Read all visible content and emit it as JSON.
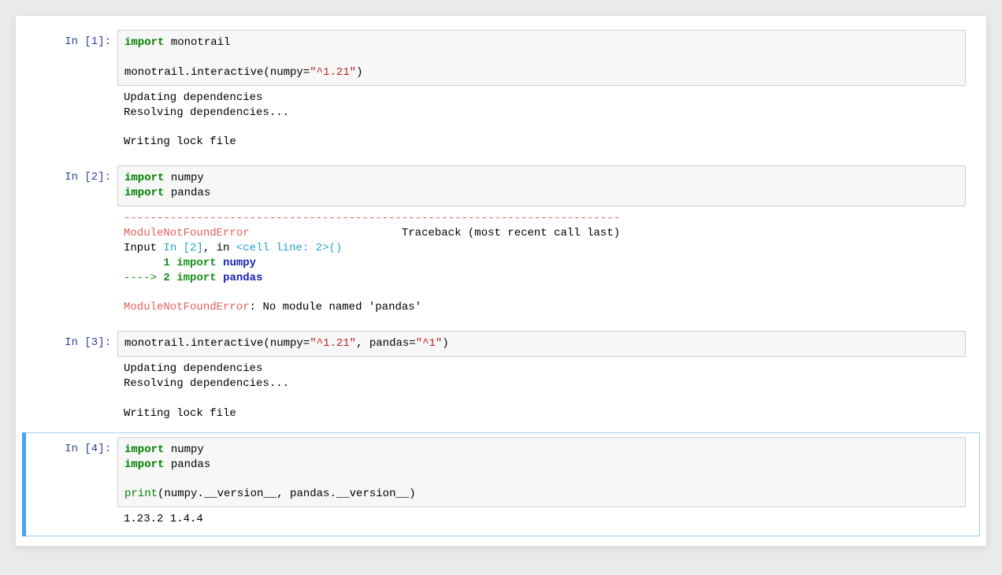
{
  "cells": [
    {
      "selected": false,
      "prompt": "In [1]:",
      "code_tokens": [
        [
          "kw",
          "import"
        ],
        [
          "sp",
          " "
        ],
        [
          "txt",
          "monotrail"
        ],
        [
          "nl"
        ],
        [
          "nl"
        ],
        [
          "txt",
          "monotrail.interactive(numpy"
        ],
        [
          "punct",
          "="
        ],
        [
          "str",
          "\"^1.21\""
        ],
        [
          "txt",
          ")"
        ]
      ],
      "output_segments": [
        {
          "type": "plain",
          "text": "Updating dependencies\nResolving dependencies...\n\nWriting lock file"
        }
      ]
    },
    {
      "selected": false,
      "prompt": "In [2]:",
      "code_tokens": [
        [
          "kw",
          "import"
        ],
        [
          "sp",
          " "
        ],
        [
          "txt",
          "numpy"
        ],
        [
          "nl"
        ],
        [
          "kw",
          "import"
        ],
        [
          "sp",
          " "
        ],
        [
          "txt",
          "pandas"
        ]
      ],
      "output_segments": [
        {
          "type": "err-dash",
          "text": "---------------------------------------------------------------------------"
        },
        {
          "type": "nl"
        },
        {
          "type": "err-name",
          "text": "ModuleNotFoundError"
        },
        {
          "type": "plain",
          "text": "                       Traceback (most recent call last)"
        },
        {
          "type": "nl"
        },
        {
          "type": "plain",
          "text": "Input "
        },
        {
          "type": "cell-loc",
          "text": "In [2]"
        },
        {
          "type": "plain",
          "text": ", in "
        },
        {
          "type": "cell-loc",
          "text": "<cell line: 2>"
        },
        {
          "type": "cell-loc",
          "text": "()"
        },
        {
          "type": "nl"
        },
        {
          "type": "num",
          "text": "      1"
        },
        {
          "type": "plain",
          "text": " "
        },
        {
          "type": "kw",
          "text": "import"
        },
        {
          "type": "plain",
          "text": " "
        },
        {
          "type": "mod",
          "text": "numpy"
        },
        {
          "type": "nl"
        },
        {
          "type": "arrow",
          "text": "----> "
        },
        {
          "type": "num",
          "text": "2"
        },
        {
          "type": "plain",
          "text": " "
        },
        {
          "type": "kw",
          "text": "import"
        },
        {
          "type": "plain",
          "text": " "
        },
        {
          "type": "mod",
          "text": "pandas"
        },
        {
          "type": "nl"
        },
        {
          "type": "nl"
        },
        {
          "type": "err-name",
          "text": "ModuleNotFoundError"
        },
        {
          "type": "plain",
          "text": ": No module named 'pandas'"
        }
      ]
    },
    {
      "selected": false,
      "prompt": "In [3]:",
      "code_tokens": [
        [
          "txt",
          "monotrail.interactive(numpy"
        ],
        [
          "punct",
          "="
        ],
        [
          "str",
          "\"^1.21\""
        ],
        [
          "txt",
          ", pandas"
        ],
        [
          "punct",
          "="
        ],
        [
          "str",
          "\"^1\""
        ],
        [
          "txt",
          ")"
        ]
      ],
      "output_segments": [
        {
          "type": "plain",
          "text": "Updating dependencies\nResolving dependencies...\n\nWriting lock file"
        }
      ]
    },
    {
      "selected": true,
      "prompt": "In [4]:",
      "code_tokens": [
        [
          "kw",
          "import"
        ],
        [
          "sp",
          " "
        ],
        [
          "txt",
          "numpy"
        ],
        [
          "nl"
        ],
        [
          "kw",
          "import"
        ],
        [
          "sp",
          " "
        ],
        [
          "txt",
          "pandas"
        ],
        [
          "nl"
        ],
        [
          "nl"
        ],
        [
          "builtin",
          "print"
        ],
        [
          "txt",
          "(numpy.__version__, pandas.__version__)"
        ]
      ],
      "output_segments": [
        {
          "type": "plain",
          "text": "1.23.2 1.4.4"
        }
      ]
    }
  ]
}
